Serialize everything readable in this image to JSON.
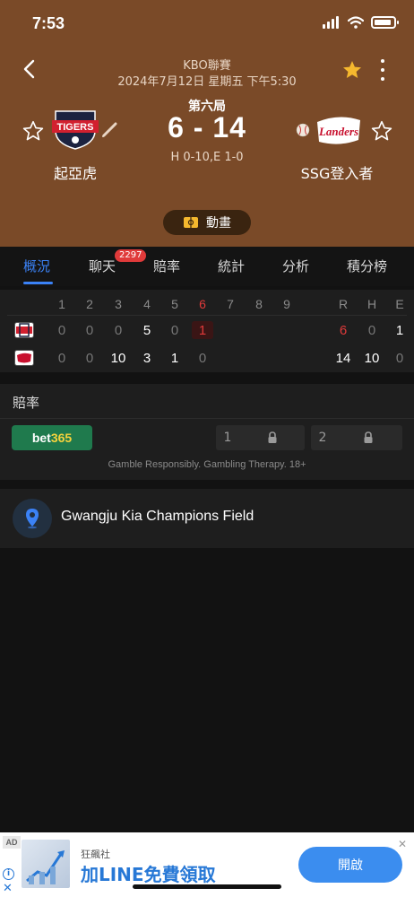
{
  "status_bar": {
    "time": "7:53"
  },
  "header": {
    "league": "KBO聯賽",
    "datetime": "2024年7月12日 星期五 下午5:30",
    "inning": "第六局",
    "score": "6 - 14",
    "he_summary": "H 0-10,E 1-0",
    "home_team": {
      "name": "起亞虎",
      "logo_text": "TIGERS"
    },
    "away_team": {
      "name": "SSG登入者",
      "logo_text": "Landers"
    },
    "animation_label": "動畫",
    "colors": {
      "background": "#7a4a28",
      "favorite": "#f5b82e"
    }
  },
  "tabs": [
    {
      "label": "概況",
      "active": true
    },
    {
      "label": "聊天",
      "badge": "2297"
    },
    {
      "label": "賠率"
    },
    {
      "label": "統計"
    },
    {
      "label": "分析"
    },
    {
      "label": "積分榜"
    }
  ],
  "line_score": {
    "innings": [
      "1",
      "2",
      "3",
      "4",
      "5",
      "6",
      "7",
      "8",
      "9"
    ],
    "totals_headers": [
      "R",
      "H",
      "E"
    ],
    "current_inning": "6",
    "home": {
      "innings": [
        "0",
        "0",
        "0",
        "5",
        "0",
        "1"
      ],
      "totals": [
        "6",
        "0",
        "1"
      ]
    },
    "away": {
      "innings": [
        "0",
        "0",
        "10",
        "3",
        "1",
        "0"
      ],
      "totals": [
        "14",
        "10",
        "0"
      ]
    }
  },
  "odds": {
    "title": "賠率",
    "bookmaker": {
      "prefix": "bet",
      "suffix": "365"
    },
    "options": [
      {
        "label": "1"
      },
      {
        "label": "2"
      }
    ],
    "note": "Gamble Responsibly. Gambling Therapy. 18+"
  },
  "venue": {
    "name": "Gwangju Kia Champions Field"
  },
  "ad": {
    "tag": "AD",
    "brand": "狂飆社",
    "headline": "加LINE免費領取",
    "cta": "開啟",
    "close": "✕",
    "info": "i",
    "x": "✕"
  }
}
